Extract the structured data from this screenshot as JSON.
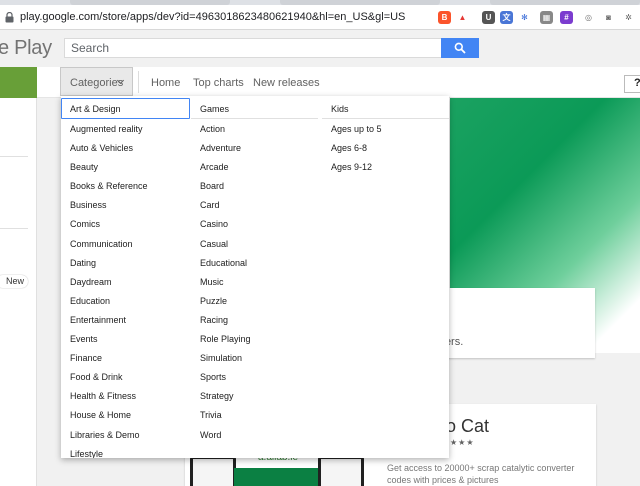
{
  "browser": {
    "url": "play.google.com/store/apps/dev?id=4963018623480621940&hl=en_US&gl=US"
  },
  "header": {
    "brand": "e Play",
    "search_placeholder": "Search"
  },
  "nav": {
    "categories_label": "Categories",
    "links": [
      "Home",
      "Top charts",
      "New releases"
    ],
    "help": "?"
  },
  "sidebar": {
    "new_badge": "New"
  },
  "categories": {
    "col1": {
      "header": "Art & Design",
      "items": [
        "Augmented reality",
        "Auto & Vehicles",
        "Beauty",
        "Books & Reference",
        "Business",
        "Comics",
        "Communication",
        "Dating",
        "Daydream",
        "Education",
        "Entertainment",
        "Events",
        "Finance",
        "Food & Drink",
        "Health & Fitness",
        "House & Home",
        "Libraries & Demo",
        "Lifestyle"
      ]
    },
    "col2": {
      "header": "Games",
      "items": [
        "Action",
        "Adventure",
        "Arcade",
        "Board",
        "Card",
        "Casino",
        "Casual",
        "Educational",
        "Music",
        "Puzzle",
        "Racing",
        "Role Playing",
        "Simulation",
        "Sports",
        "Strategy",
        "Trivia",
        "Word"
      ]
    },
    "col3": {
      "header": "Kids",
      "items": [
        "Ages up to 5",
        "Ages 6-8",
        "Ages 9-12"
      ]
    }
  },
  "background": {
    "card_text": "clers.",
    "app_title": "co Cat",
    "stars": "★★★",
    "app_desc": "Get access to 20000+ scrap catalytic converter codes with prices & pictures",
    "available_text": "a.allab.le"
  },
  "colors": {
    "accent_blue": "#4285f4",
    "play_green": "#689f38",
    "hero_green": "#0b9a57"
  }
}
